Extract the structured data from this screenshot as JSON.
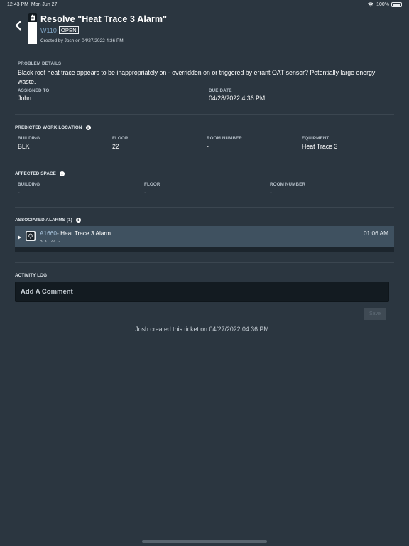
{
  "status_bar": {
    "time": "12:43 PM",
    "date": "Mon Jun 27",
    "battery": "100%",
    "battery_level": 1.0
  },
  "header": {
    "title": "Resolve \"Heat Trace 3 Alarm\"",
    "work_order": "W110",
    "status": "OPEN",
    "created_by": "Created by Josh on 04/27/2022 4:36 PM"
  },
  "details": {
    "problem_label": "PROBLEM DETAILS",
    "problem_text": "Black roof heat trace appears to be inappropriately on - overridden on or triggered by errant OAT sensor? Potentially large energy waste.",
    "assigned_label": "ASSIGNED TO",
    "assigned_value": "John",
    "due_label": "DUE DATE",
    "due_value": "04/28/2022 4:36 PM"
  },
  "predicted_location": {
    "title": "PREDICTED WORK LOCATION",
    "building_label": "BUILDING",
    "building_value": "BLK",
    "floor_label": "FLOOR",
    "floor_value": "22",
    "room_label": "ROOM NUMBER",
    "room_value": "-",
    "equipment_label": "EQUIPMENT",
    "equipment_value": "Heat Trace 3"
  },
  "affected_space": {
    "title": "AFFECTED SPACE",
    "building_label": "BUILDING",
    "building_value": "-",
    "floor_label": "FLOOR",
    "floor_value": "-",
    "room_label": "ROOM NUMBER",
    "room_value": "-"
  },
  "alarms": {
    "title": "ASSOCIATED ALARMS (1)",
    "items": [
      {
        "id": "A1660",
        "name": "- Heat Trace 3 Alarm",
        "time": "01:06 AM",
        "building": "BLK",
        "floor": "22",
        "room": "-"
      }
    ]
  },
  "activity": {
    "title": "ACTIVITY LOG",
    "comment_placeholder": "Add A Comment",
    "save_label": "Save",
    "entries": [
      "Josh created this ticket on 04/27/2022 04:36 PM"
    ]
  },
  "colors": {
    "background": "#2b3640",
    "accent_link": "#7ea3c3",
    "alarm_row": "#3f5160",
    "input_bg": "#131b21"
  }
}
